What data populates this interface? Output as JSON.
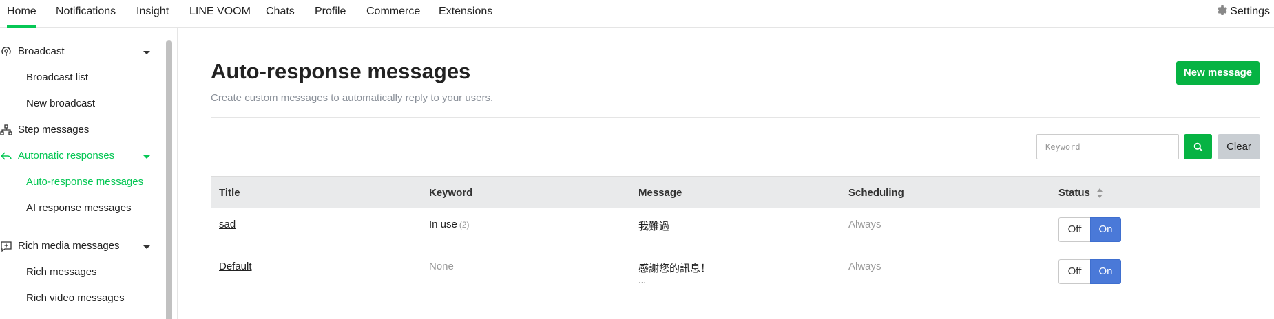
{
  "topnav": {
    "tabs": [
      "Home",
      "Notifications",
      "Insight",
      "LINE VOOM",
      "Chats",
      "Profile",
      "Commerce",
      "Extensions"
    ],
    "active": "Home",
    "settings_label": "Settings"
  },
  "sidebar": {
    "broadcast": "Broadcast",
    "broadcast_list": "Broadcast list",
    "new_broadcast": "New broadcast",
    "step_messages": "Step messages",
    "automatic_responses": "Automatic responses",
    "auto_response_messages": "Auto-response messages",
    "ai_response_messages": "AI response messages",
    "rich_media_messages": "Rich media messages",
    "rich_messages": "Rich messages",
    "rich_video_messages": "Rich video messages"
  },
  "main": {
    "title": "Auto-response messages",
    "subtitle": "Create custom messages to automatically reply to your users.",
    "new_message_label": "New message",
    "keyword_placeholder": "Keyword",
    "clear_label": "Clear"
  },
  "table": {
    "headers": {
      "title": "Title",
      "keyword": "Keyword",
      "message": "Message",
      "scheduling": "Scheduling",
      "status": "Status"
    },
    "rows": [
      {
        "title": "sad",
        "keyword": "In use",
        "keyword_count": "(2)",
        "message": "我難過",
        "message_more": "",
        "scheduling": "Always",
        "off": "Off",
        "on": "On",
        "status": "On"
      },
      {
        "title": "Default",
        "keyword": "None",
        "keyword_count": "",
        "message": "感謝您的訊息！",
        "message_more": "...",
        "scheduling": "Always",
        "off": "Off",
        "on": "On",
        "status": "On"
      }
    ]
  },
  "colors": {
    "brand_green": "#06c755",
    "button_green": "#06b343",
    "toggle_blue": "#4a79d8"
  }
}
